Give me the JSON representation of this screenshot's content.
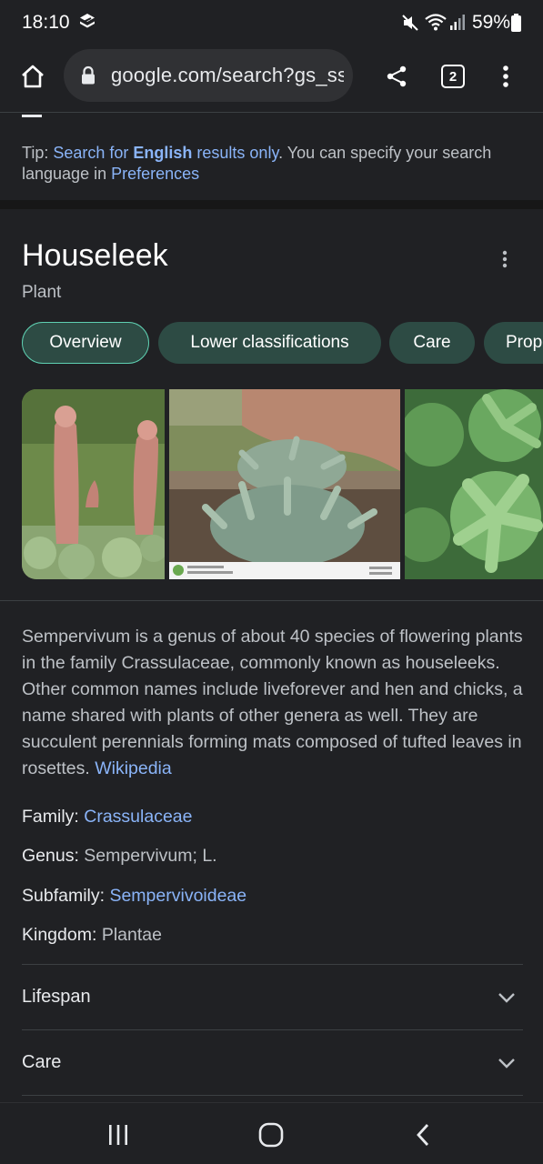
{
  "status_bar": {
    "time": "18:10",
    "battery": "59%"
  },
  "browser": {
    "url": "google.com/search?gs_ssp",
    "tab_count": "2"
  },
  "tip": {
    "prefix": "Tip: ",
    "link1_a": "Search for ",
    "link1_bold": "English",
    "link1_b": " results only",
    "middle": ". You can specify your search language in ",
    "link2": "Preferences"
  },
  "knowledge_panel": {
    "title": "Houseleek",
    "subtitle": "Plant",
    "chips": [
      {
        "label": "Overview"
      },
      {
        "label": "Lower classifications"
      },
      {
        "label": "Care"
      },
      {
        "label": "Properties"
      }
    ],
    "description": "Sempervivum is a genus of about 40 species of flowering plants in the family Crassulaceae, commonly known as houseleeks. Other common names include liveforever and hen and chicks, a name shared with plants of other genera as well. They are succulent perennials forming mats composed of tufted leaves in rosettes. ",
    "source_link": "Wikipedia",
    "facts": [
      {
        "label": "Family: ",
        "value": "Crassulaceae"
      },
      {
        "label": "Genus: ",
        "value": "Sempervivum; L."
      },
      {
        "label": "Subfamily: ",
        "value": "Sempervivoideae"
      },
      {
        "label": "Kingdom: ",
        "value": "Plantae"
      }
    ],
    "accordions": [
      {
        "label": "Lifespan"
      },
      {
        "label": "Care"
      }
    ]
  },
  "colors": {
    "background": "#202124",
    "link": "#8ab4f8",
    "chip_bg": "#2d4b44",
    "chip_selected_border": "#5fd0b2"
  }
}
